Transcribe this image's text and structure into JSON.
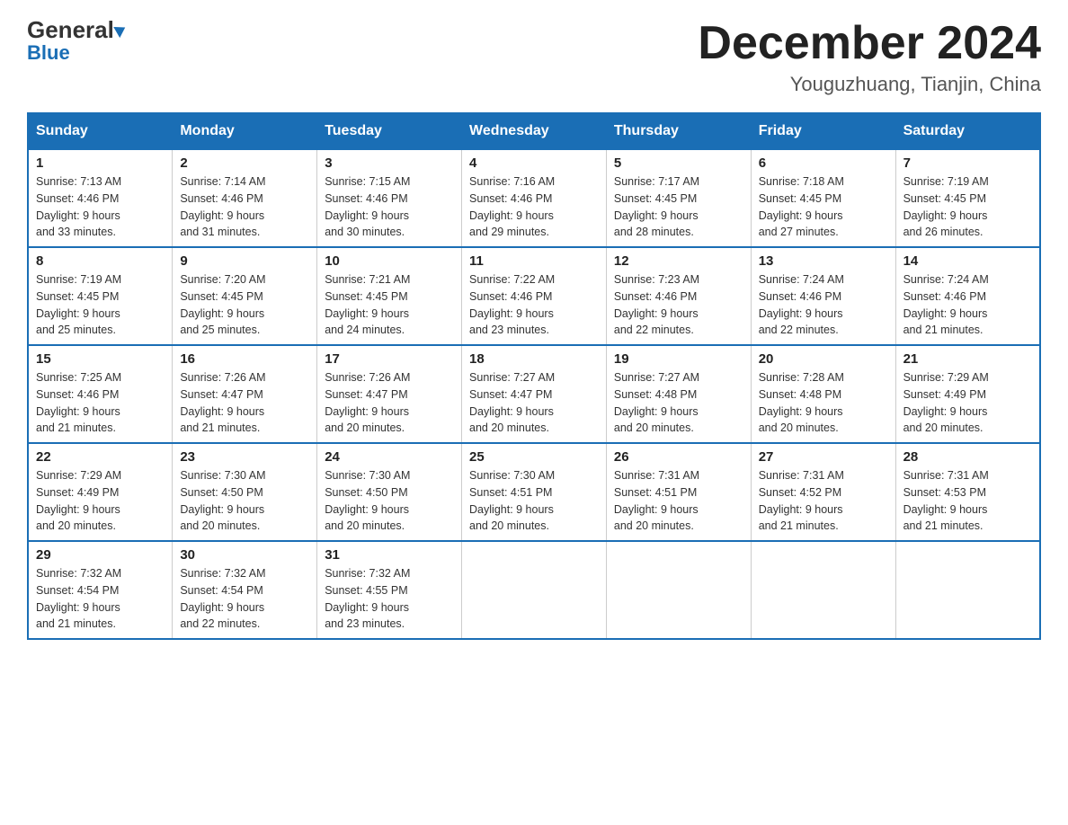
{
  "logo": {
    "general": "General",
    "blue": "Blue",
    "triangle_char": "▶"
  },
  "header": {
    "month_year": "December 2024",
    "location": "Youguzhuang, Tianjin, China"
  },
  "days_of_week": [
    "Sunday",
    "Monday",
    "Tuesday",
    "Wednesday",
    "Thursday",
    "Friday",
    "Saturday"
  ],
  "weeks": [
    [
      {
        "day": "1",
        "sunrise": "Sunrise: 7:13 AM",
        "sunset": "Sunset: 4:46 PM",
        "daylight": "Daylight: 9 hours",
        "minutes": "and 33 minutes."
      },
      {
        "day": "2",
        "sunrise": "Sunrise: 7:14 AM",
        "sunset": "Sunset: 4:46 PM",
        "daylight": "Daylight: 9 hours",
        "minutes": "and 31 minutes."
      },
      {
        "day": "3",
        "sunrise": "Sunrise: 7:15 AM",
        "sunset": "Sunset: 4:46 PM",
        "daylight": "Daylight: 9 hours",
        "minutes": "and 30 minutes."
      },
      {
        "day": "4",
        "sunrise": "Sunrise: 7:16 AM",
        "sunset": "Sunset: 4:46 PM",
        "daylight": "Daylight: 9 hours",
        "minutes": "and 29 minutes."
      },
      {
        "day": "5",
        "sunrise": "Sunrise: 7:17 AM",
        "sunset": "Sunset: 4:45 PM",
        "daylight": "Daylight: 9 hours",
        "minutes": "and 28 minutes."
      },
      {
        "day": "6",
        "sunrise": "Sunrise: 7:18 AM",
        "sunset": "Sunset: 4:45 PM",
        "daylight": "Daylight: 9 hours",
        "minutes": "and 27 minutes."
      },
      {
        "day": "7",
        "sunrise": "Sunrise: 7:19 AM",
        "sunset": "Sunset: 4:45 PM",
        "daylight": "Daylight: 9 hours",
        "minutes": "and 26 minutes."
      }
    ],
    [
      {
        "day": "8",
        "sunrise": "Sunrise: 7:19 AM",
        "sunset": "Sunset: 4:45 PM",
        "daylight": "Daylight: 9 hours",
        "minutes": "and 25 minutes."
      },
      {
        "day": "9",
        "sunrise": "Sunrise: 7:20 AM",
        "sunset": "Sunset: 4:45 PM",
        "daylight": "Daylight: 9 hours",
        "minutes": "and 25 minutes."
      },
      {
        "day": "10",
        "sunrise": "Sunrise: 7:21 AM",
        "sunset": "Sunset: 4:45 PM",
        "daylight": "Daylight: 9 hours",
        "minutes": "and 24 minutes."
      },
      {
        "day": "11",
        "sunrise": "Sunrise: 7:22 AM",
        "sunset": "Sunset: 4:46 PM",
        "daylight": "Daylight: 9 hours",
        "minutes": "and 23 minutes."
      },
      {
        "day": "12",
        "sunrise": "Sunrise: 7:23 AM",
        "sunset": "Sunset: 4:46 PM",
        "daylight": "Daylight: 9 hours",
        "minutes": "and 22 minutes."
      },
      {
        "day": "13",
        "sunrise": "Sunrise: 7:24 AM",
        "sunset": "Sunset: 4:46 PM",
        "daylight": "Daylight: 9 hours",
        "minutes": "and 22 minutes."
      },
      {
        "day": "14",
        "sunrise": "Sunrise: 7:24 AM",
        "sunset": "Sunset: 4:46 PM",
        "daylight": "Daylight: 9 hours",
        "minutes": "and 21 minutes."
      }
    ],
    [
      {
        "day": "15",
        "sunrise": "Sunrise: 7:25 AM",
        "sunset": "Sunset: 4:46 PM",
        "daylight": "Daylight: 9 hours",
        "minutes": "and 21 minutes."
      },
      {
        "day": "16",
        "sunrise": "Sunrise: 7:26 AM",
        "sunset": "Sunset: 4:47 PM",
        "daylight": "Daylight: 9 hours",
        "minutes": "and 21 minutes."
      },
      {
        "day": "17",
        "sunrise": "Sunrise: 7:26 AM",
        "sunset": "Sunset: 4:47 PM",
        "daylight": "Daylight: 9 hours",
        "minutes": "and 20 minutes."
      },
      {
        "day": "18",
        "sunrise": "Sunrise: 7:27 AM",
        "sunset": "Sunset: 4:47 PM",
        "daylight": "Daylight: 9 hours",
        "minutes": "and 20 minutes."
      },
      {
        "day": "19",
        "sunrise": "Sunrise: 7:27 AM",
        "sunset": "Sunset: 4:48 PM",
        "daylight": "Daylight: 9 hours",
        "minutes": "and 20 minutes."
      },
      {
        "day": "20",
        "sunrise": "Sunrise: 7:28 AM",
        "sunset": "Sunset: 4:48 PM",
        "daylight": "Daylight: 9 hours",
        "minutes": "and 20 minutes."
      },
      {
        "day": "21",
        "sunrise": "Sunrise: 7:29 AM",
        "sunset": "Sunset: 4:49 PM",
        "daylight": "Daylight: 9 hours",
        "minutes": "and 20 minutes."
      }
    ],
    [
      {
        "day": "22",
        "sunrise": "Sunrise: 7:29 AM",
        "sunset": "Sunset: 4:49 PM",
        "daylight": "Daylight: 9 hours",
        "minutes": "and 20 minutes."
      },
      {
        "day": "23",
        "sunrise": "Sunrise: 7:30 AM",
        "sunset": "Sunset: 4:50 PM",
        "daylight": "Daylight: 9 hours",
        "minutes": "and 20 minutes."
      },
      {
        "day": "24",
        "sunrise": "Sunrise: 7:30 AM",
        "sunset": "Sunset: 4:50 PM",
        "daylight": "Daylight: 9 hours",
        "minutes": "and 20 minutes."
      },
      {
        "day": "25",
        "sunrise": "Sunrise: 7:30 AM",
        "sunset": "Sunset: 4:51 PM",
        "daylight": "Daylight: 9 hours",
        "minutes": "and 20 minutes."
      },
      {
        "day": "26",
        "sunrise": "Sunrise: 7:31 AM",
        "sunset": "Sunset: 4:51 PM",
        "daylight": "Daylight: 9 hours",
        "minutes": "and 20 minutes."
      },
      {
        "day": "27",
        "sunrise": "Sunrise: 7:31 AM",
        "sunset": "Sunset: 4:52 PM",
        "daylight": "Daylight: 9 hours",
        "minutes": "and 21 minutes."
      },
      {
        "day": "28",
        "sunrise": "Sunrise: 7:31 AM",
        "sunset": "Sunset: 4:53 PM",
        "daylight": "Daylight: 9 hours",
        "minutes": "and 21 minutes."
      }
    ],
    [
      {
        "day": "29",
        "sunrise": "Sunrise: 7:32 AM",
        "sunset": "Sunset: 4:54 PM",
        "daylight": "Daylight: 9 hours",
        "minutes": "and 21 minutes."
      },
      {
        "day": "30",
        "sunrise": "Sunrise: 7:32 AM",
        "sunset": "Sunset: 4:54 PM",
        "daylight": "Daylight: 9 hours",
        "minutes": "and 22 minutes."
      },
      {
        "day": "31",
        "sunrise": "Sunrise: 7:32 AM",
        "sunset": "Sunset: 4:55 PM",
        "daylight": "Daylight: 9 hours",
        "minutes": "and 23 minutes."
      },
      null,
      null,
      null,
      null
    ]
  ]
}
